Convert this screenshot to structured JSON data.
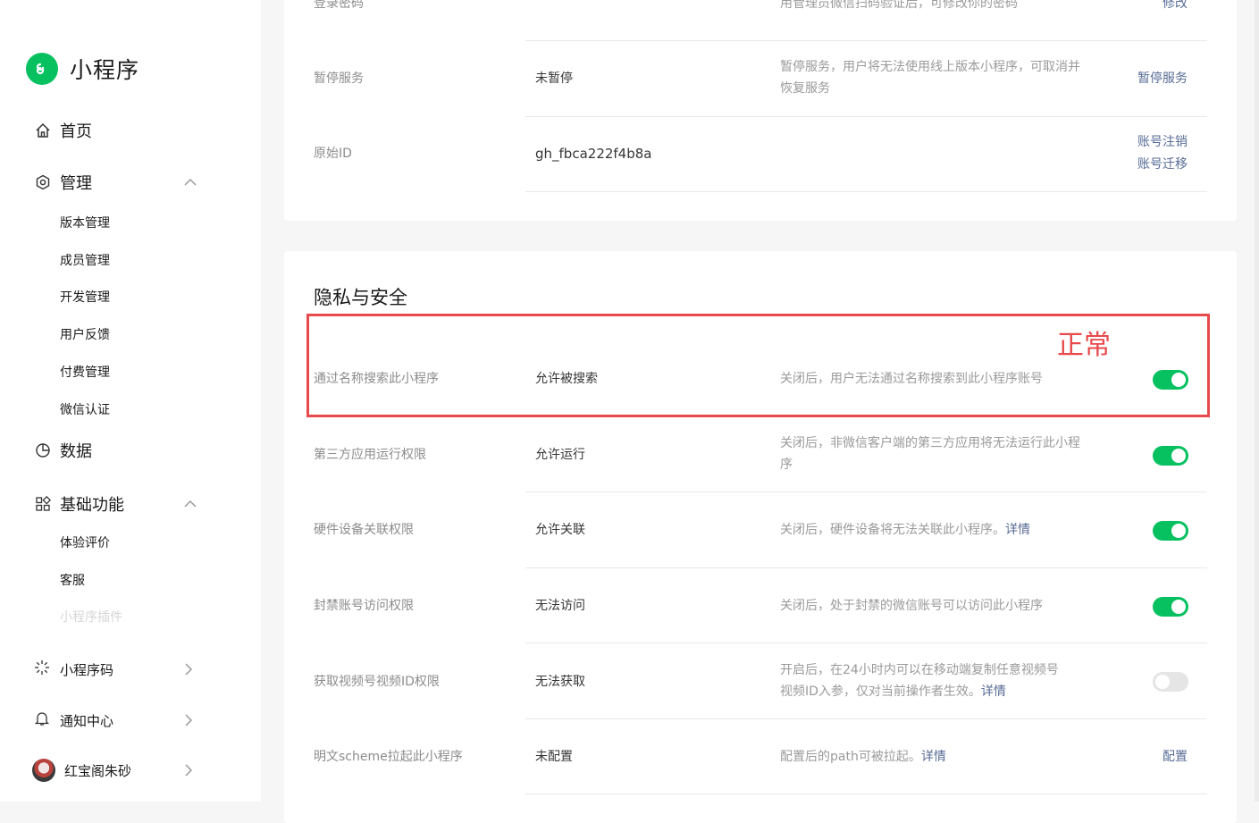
{
  "app": {
    "title": "小程序"
  },
  "sidebar": {
    "home": "首页",
    "manage": "管理",
    "manage_items": [
      "版本管理",
      "成员管理",
      "开发管理",
      "用户反馈",
      "付费管理",
      "微信认证"
    ],
    "data": "数据",
    "basic": "基础功能",
    "basic_items": [
      "体验评价",
      "客服",
      "小程序插件"
    ],
    "qrcode": "小程序码",
    "notify": "通知中心",
    "user": "红宝阁朱砂"
  },
  "top_rows": [
    {
      "name": "登录密码",
      "value": "",
      "desc": "用管理员微信扫码验证后，可修改你的密码",
      "action": "修改"
    },
    {
      "name": "暂停服务",
      "value": "未暂停",
      "desc": "暂停服务，用户将无法使用线上版本小程序，可取消并恢复服务",
      "action": "暂停服务"
    },
    {
      "name": "原始ID",
      "value": "gh_fbca222f4b8a",
      "desc": "",
      "action1": "账号注销",
      "action2": "账号迁移"
    }
  ],
  "privacy": {
    "title": "隐私与安全",
    "annotation": "正常",
    "rows": [
      {
        "name": "通过名称搜索此小程序",
        "value": "允许被搜索",
        "desc": "关闭后，用户无法通过名称搜索到此小程序账号",
        "on": true
      },
      {
        "name": "第三方应用运行权限",
        "value": "允许运行",
        "desc": "关闭后，非微信客户端的第三方应用将无法运行此小程序",
        "on": true
      },
      {
        "name": "硬件设备关联权限",
        "value": "允许关联",
        "desc": "关闭后，硬件设备将无法关联此小程序。",
        "link": "详情",
        "on": true
      },
      {
        "name": "封禁账号访问权限",
        "value": "无法访问",
        "desc": "关闭后，处于封禁的微信账号可以访问此小程序",
        "on": true
      },
      {
        "name": "获取视频号视频ID权限",
        "value": "无法获取",
        "desc": "开启后，在24小时内可以在移动端复制任意视频号视频ID入参，仅对当前操作者生效。",
        "link": "详情",
        "on": false
      },
      {
        "name": "明文scheme拉起此小程序",
        "value": "未配置",
        "desc": "配置后的path可被拉起。",
        "link": "详情",
        "action": "配置"
      }
    ]
  },
  "colors": {
    "brand": "#07c160",
    "link": "#576b95",
    "highlight": "#e8494b"
  }
}
